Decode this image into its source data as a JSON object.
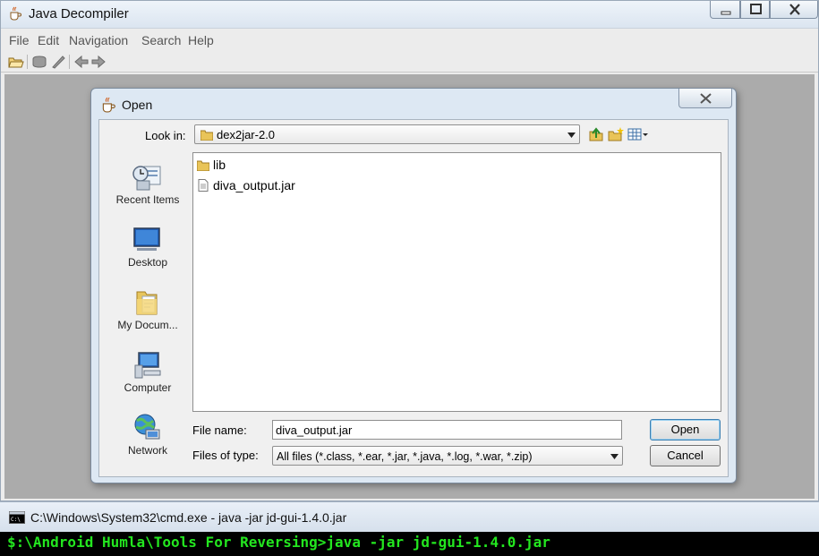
{
  "window": {
    "title": "Java Decompiler"
  },
  "menu": [
    "File",
    "Edit",
    "Navigation",
    "Search",
    "Help"
  ],
  "toolbar": {
    "icons": [
      "open-file-icon",
      "open-type-icon",
      "search-icon",
      "back-icon",
      "forward-icon"
    ]
  },
  "dialog": {
    "title": "Open",
    "look_in_label": "Look in:",
    "look_in_value": "dex2jar-2.0",
    "places": [
      {
        "label": "Recent Items",
        "icon": "recent-items-icon"
      },
      {
        "label": "Desktop",
        "icon": "desktop-icon"
      },
      {
        "label": "My Docum...",
        "icon": "documents-icon"
      },
      {
        "label": "Computer",
        "icon": "computer-icon"
      },
      {
        "label": "Network",
        "icon": "network-icon"
      }
    ],
    "files": [
      {
        "name": "lib",
        "type": "folder"
      },
      {
        "name": "diva_output.jar",
        "type": "file"
      }
    ],
    "file_name_label": "File name:",
    "file_name_value": "diva_output.jar",
    "file_type_label": "Files of type:",
    "file_type_value": "All files (*.class, *.ear, *.jar, *.java, *.log, *.war, *.zip)",
    "open_button": "Open",
    "cancel_button": "Cancel"
  },
  "cmd": {
    "title": "C:\\Windows\\System32\\cmd.exe - java  -jar jd-gui-1.4.0.jar",
    "line": "$:\\Android Humla\\Tools For Reversing>java -jar jd-gui-1.4.0.jar"
  },
  "colors": {
    "console_text": "#23e61f",
    "console_bg": "#000000",
    "dialog_frame": "#dde8f3"
  }
}
